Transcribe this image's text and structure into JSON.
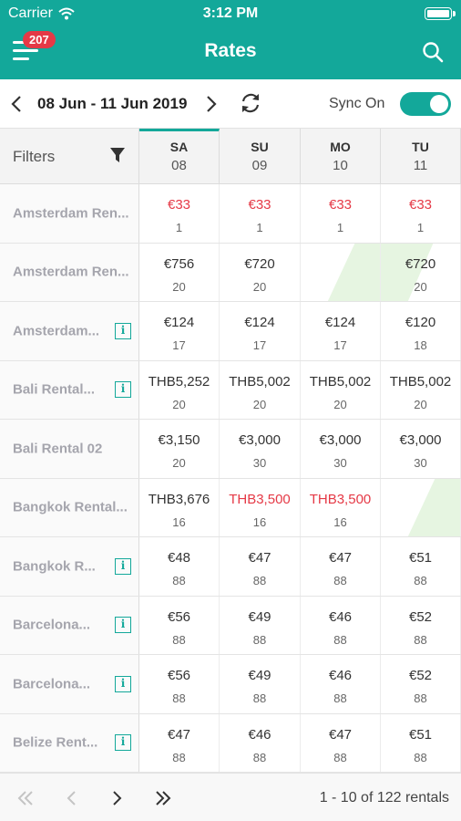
{
  "status_bar": {
    "carrier": "Carrier",
    "time": "3:12 PM"
  },
  "header": {
    "title": "Rates",
    "badge_count": "207",
    "menu_icon": "hamburger-menu-icon",
    "search_icon": "search-icon"
  },
  "date_bar": {
    "range": "08 Jun - 11 Jun 2019",
    "sync_label": "Sync On",
    "sync_on": true
  },
  "filters": {
    "label": "Filters"
  },
  "days": [
    {
      "dow": "SA",
      "dom": "08",
      "active": true
    },
    {
      "dow": "SU",
      "dom": "09",
      "active": false
    },
    {
      "dow": "MO",
      "dom": "10",
      "active": false
    },
    {
      "dow": "TU",
      "dom": "11",
      "active": false
    }
  ],
  "rentals": [
    {
      "name": "Amsterdam Ren...",
      "info": false,
      "cells": [
        {
          "price": "€33",
          "avail": "1",
          "red": true
        },
        {
          "price": "€33",
          "avail": "1",
          "red": true
        },
        {
          "price": "€33",
          "avail": "1",
          "red": true
        },
        {
          "price": "€33",
          "avail": "1",
          "red": true
        }
      ]
    },
    {
      "name": "Amsterdam Ren...",
      "info": false,
      "cells": [
        {
          "price": "€756",
          "avail": "20"
        },
        {
          "price": "€720",
          "avail": "20"
        },
        {
          "blocked": "start"
        },
        {
          "price": "€720",
          "avail": "20",
          "blocked": "end"
        }
      ]
    },
    {
      "name": "Amsterdam...",
      "info": true,
      "cells": [
        {
          "price": "€124",
          "avail": "17"
        },
        {
          "price": "€124",
          "avail": "17"
        },
        {
          "price": "€124",
          "avail": "17"
        },
        {
          "price": "€120",
          "avail": "18"
        }
      ]
    },
    {
      "name": "Bali Rental...",
      "info": true,
      "cells": [
        {
          "price": "THB5,252",
          "avail": "20"
        },
        {
          "price": "THB5,002",
          "avail": "20"
        },
        {
          "price": "THB5,002",
          "avail": "20"
        },
        {
          "price": "THB5,002",
          "avail": "20"
        }
      ]
    },
    {
      "name": "Bali Rental 02",
      "info": false,
      "cells": [
        {
          "price": "€3,150",
          "avail": "20"
        },
        {
          "price": "€3,000",
          "avail": "30"
        },
        {
          "price": "€3,000",
          "avail": "30"
        },
        {
          "price": "€3,000",
          "avail": "30"
        }
      ]
    },
    {
      "name": "Bangkok Rental...",
      "info": false,
      "cells": [
        {
          "price": "THB3,676",
          "avail": "16"
        },
        {
          "price": "THB3,500",
          "avail": "16",
          "red": true
        },
        {
          "price": "THB3,500",
          "avail": "16",
          "red": true
        },
        {
          "blocked": "start"
        }
      ]
    },
    {
      "name": "Bangkok R...",
      "info": true,
      "cells": [
        {
          "price": "€48",
          "avail": "88"
        },
        {
          "price": "€47",
          "avail": "88"
        },
        {
          "price": "€47",
          "avail": "88"
        },
        {
          "price": "€51",
          "avail": "88"
        }
      ]
    },
    {
      "name": "Barcelona...",
      "info": true,
      "cells": [
        {
          "price": "€56",
          "avail": "88"
        },
        {
          "price": "€49",
          "avail": "88"
        },
        {
          "price": "€46",
          "avail": "88"
        },
        {
          "price": "€52",
          "avail": "88"
        }
      ]
    },
    {
      "name": "Barcelona...",
      "info": true,
      "cells": [
        {
          "price": "€56",
          "avail": "88"
        },
        {
          "price": "€49",
          "avail": "88"
        },
        {
          "price": "€46",
          "avail": "88"
        },
        {
          "price": "€52",
          "avail": "88"
        }
      ]
    },
    {
      "name": "Belize Rent...",
      "info": true,
      "cells": [
        {
          "price": "€47",
          "avail": "88"
        },
        {
          "price": "€46",
          "avail": "88"
        },
        {
          "price": "€47",
          "avail": "88"
        },
        {
          "price": "€51",
          "avail": "88"
        }
      ]
    }
  ],
  "info_glyph": "i",
  "pagination": {
    "summary": "1 - 10 of 122 rentals"
  },
  "colors": {
    "accent": "#13a89a",
    "alert": "#e53946",
    "blocked": "#e6f5e1"
  }
}
